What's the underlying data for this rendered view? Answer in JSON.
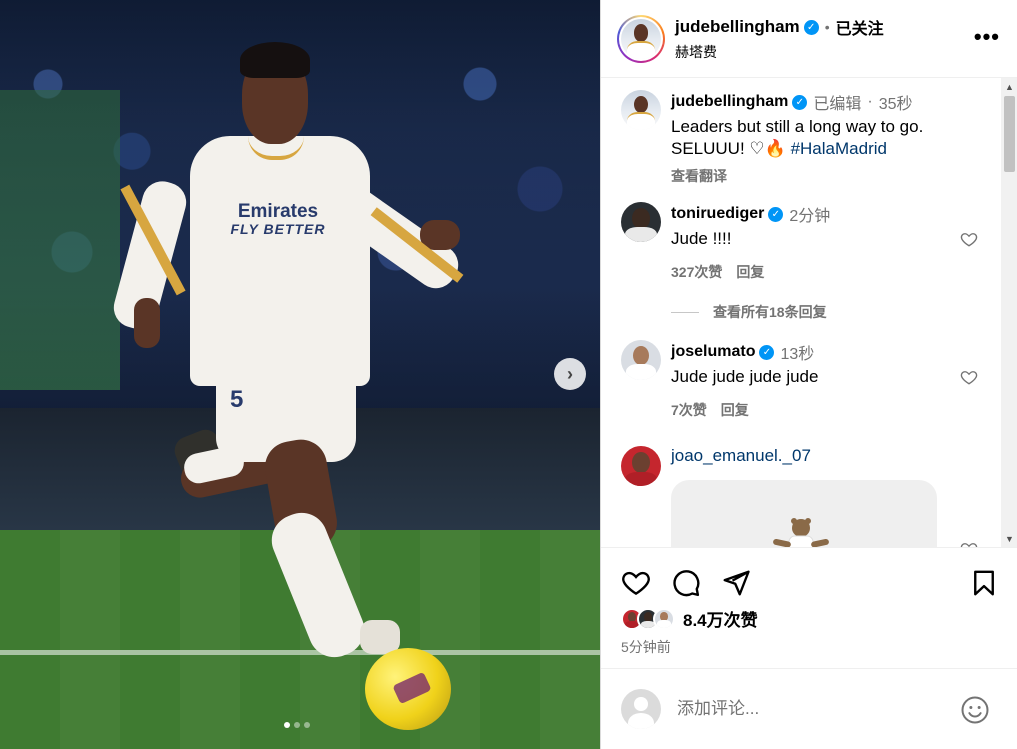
{
  "post": {
    "username": "judebellingham",
    "follow_state": "已关注",
    "location": "赫塔费"
  },
  "caption": {
    "username": "judebellingham",
    "edited": "已编辑",
    "time": "35秒",
    "text": "Leaders but still a long way to go.",
    "text2": "SELUUU! ",
    "emojis": "♡🔥",
    "hashtag": "#HalaMadrid",
    "see_translation": "查看翻译"
  },
  "comments": [
    {
      "username": "toniruediger",
      "time": "2分钟",
      "text": "Jude !!!!",
      "likes": "327次赞",
      "reply": "回复"
    },
    {
      "username": "joselumato",
      "time": "13秒",
      "text": "Jude jude jude jude",
      "likes": "7次赞",
      "reply": "回复"
    },
    {
      "username": "joao_emanuel._07"
    }
  ],
  "view_replies": "查看所有18条回复",
  "likes_count": "8.4万次赞",
  "time_ago": "5分钟前",
  "comment_placeholder": "添加评论...",
  "jersey": {
    "sponsor": "Emirates",
    "tagline": "FLY BETTER",
    "number": "5"
  },
  "carousel": {
    "total": 3,
    "active": 0
  },
  "icons": {
    "next": "chevron-right-icon",
    "more": "more-horizontal-icon",
    "like": "heart-icon",
    "comment": "comment-bubble-icon",
    "share": "paper-plane-icon",
    "save": "bookmark-icon",
    "emoji": "smiley-icon",
    "verified": "verified-badge-icon"
  },
  "colors": {
    "link": "#00376b",
    "verified": "#0095f6",
    "secondary": "#737373"
  }
}
